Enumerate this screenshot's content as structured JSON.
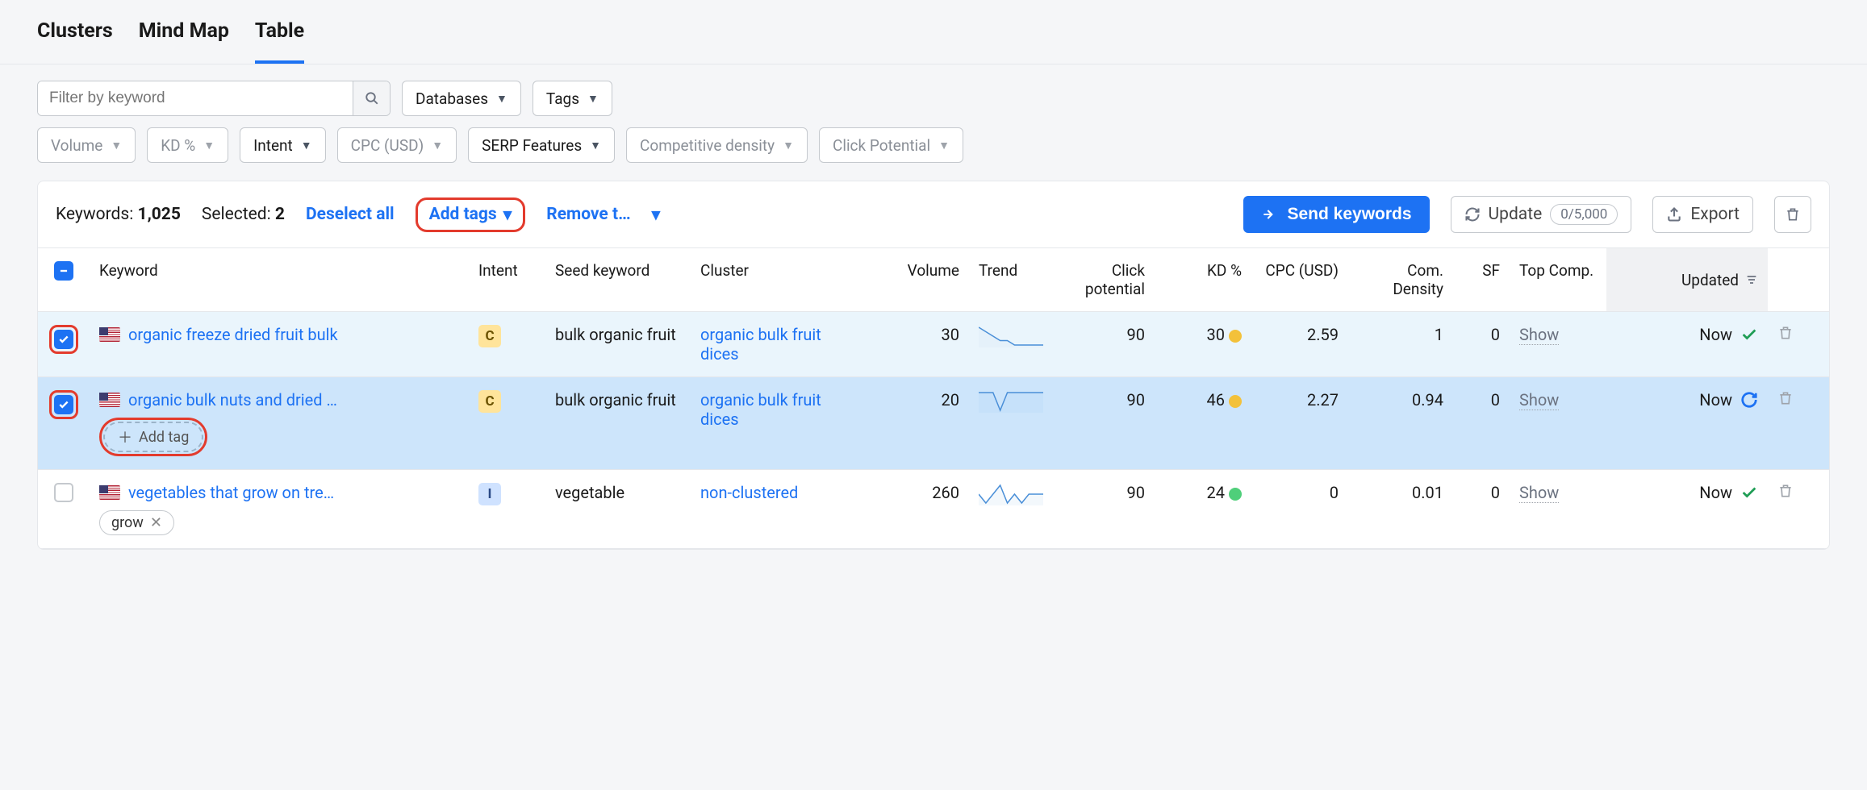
{
  "tabs": {
    "t0": "Clusters",
    "t1": "Mind Map",
    "t2": "Table"
  },
  "filters": {
    "keyword_placeholder": "Filter by keyword",
    "databases": "Databases",
    "tags": "Tags",
    "volume": "Volume",
    "kd": "KD %",
    "intent": "Intent",
    "cpc": "CPC (USD)",
    "serp": "SERP Features",
    "comp": "Competitive density",
    "click": "Click Potential"
  },
  "toolbar": {
    "keywords_label": "Keywords:",
    "keywords_count": "1,025",
    "selected_label": "Selected:",
    "selected_count": "2",
    "deselect": "Deselect all",
    "add_tags": "Add tags",
    "remove": "Remove t…",
    "send": "Send keywords",
    "update": "Update",
    "quota": "0/5,000",
    "export": "Export"
  },
  "headers": {
    "keyword": "Keyword",
    "intent": "Intent",
    "seed": "Seed keyword",
    "cluster": "Cluster",
    "volume": "Volume",
    "trend": "Trend",
    "click": "Click potential",
    "kd": "KD %",
    "cpc": "CPC (USD)",
    "com": "Com. Density",
    "sf": "SF",
    "top": "Top Comp.",
    "updated": "Updated"
  },
  "rows": [
    {
      "selected": true,
      "highlight_check": true,
      "keyword": "organic freeze dried fruit bulk",
      "intent": "C",
      "seed": "bulk organic fruit",
      "cluster": "organic bulk fruit dices",
      "volume": "30",
      "trend": [
        6,
        5,
        4,
        3,
        3,
        2,
        2,
        2,
        2,
        2
      ],
      "click": "90",
      "kd": "30",
      "kd_color": "y",
      "cpc": "2.59",
      "com": "1",
      "sf": "0",
      "top": "Show",
      "updated": "Now",
      "updated_icon": "check",
      "row_style": "sel1"
    },
    {
      "selected": true,
      "highlight_check": true,
      "keyword": "organic bulk nuts and dried …",
      "intent": "C",
      "seed": "bulk organic fruit",
      "cluster": "organic bulk fruit dices",
      "volume": "20",
      "trend": [
        4,
        4,
        4,
        2,
        4,
        4,
        4,
        4,
        4,
        4
      ],
      "click": "90",
      "kd": "46",
      "kd_color": "y",
      "cpc": "2.27",
      "com": "0.94",
      "sf": "0",
      "top": "Show",
      "updated": "Now",
      "updated_icon": "reload",
      "row_style": "sel2",
      "add_tag_label": "Add tag",
      "show_add_tag": true
    },
    {
      "selected": false,
      "keyword": "vegetables that grow on tre…",
      "intent": "I",
      "seed": "vegetable",
      "cluster": "non-clustered",
      "volume": "260",
      "trend": [
        3,
        2,
        3,
        4,
        2,
        3,
        2,
        3,
        3,
        3
      ],
      "click": "90",
      "kd": "24",
      "kd_color": "g",
      "cpc": "0",
      "com": "0.01",
      "sf": "0",
      "top": "Show",
      "updated": "Now",
      "updated_icon": "check",
      "tag": "grow"
    }
  ]
}
